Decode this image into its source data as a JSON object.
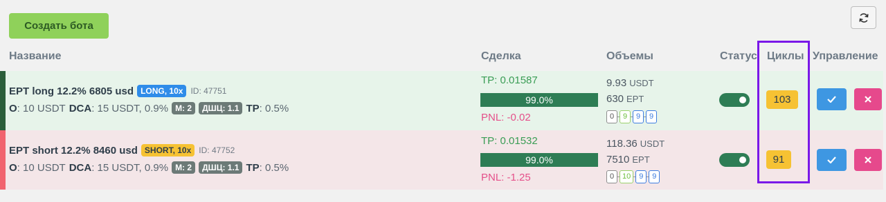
{
  "toolbar": {
    "create_label": "Создать бота",
    "refresh_icon": "refresh-icon"
  },
  "headers": {
    "name": "Название",
    "deal": "Сделка",
    "volumes": "Объемы",
    "status": "Статус",
    "cycles": "Циклы",
    "control": "Управление"
  },
  "bots": [
    {
      "title": "EPT long 12.2% 6805 usd",
      "badge": "LONG, 10x",
      "id": "ID: 47751",
      "o_label": "O",
      "o_value": ": 10 USDT",
      "dca_label": "DCA",
      "dca_value": ": 15 USDT, 0.9%",
      "m_chip": "M: 2",
      "dsh_chip": "ДШЦ: 1.1",
      "tp_label": "TP",
      "tp_value": ": 0.5%",
      "deal_tp": "TP: 0.01587",
      "progress_text": "99.0%",
      "progress": 0.99,
      "pnl": "PNL: -0.02",
      "vol_usdt": "9.93",
      "vol_usdt_unit": "USDT",
      "vol_ept": "630",
      "vol_ept_unit": "EPT",
      "cycle_boxes": [
        "0",
        "9",
        "9",
        "9"
      ],
      "enabled": true,
      "cycles": "103"
    },
    {
      "title": "EPT short 12.2% 8460 usd",
      "badge": "SHORT, 10x",
      "id": "ID: 47752",
      "o_label": "O",
      "o_value": ": 10 USDT",
      "dca_label": "DCA",
      "dca_value": ": 15 USDT, 0.9%",
      "m_chip": "M: 2",
      "dsh_chip": "ДШЦ: 1.1",
      "tp_label": "TP",
      "tp_value": ": 0.5%",
      "deal_tp": "TP: 0.01532",
      "progress_text": "99.0%",
      "progress": 0.99,
      "pnl": "PNL: -1.25",
      "vol_usdt": "118.36",
      "vol_usdt_unit": "USDT",
      "vol_ept": "7510",
      "vol_ept_unit": "EPT",
      "cycle_boxes": [
        "0",
        "10",
        "9",
        "9"
      ],
      "enabled": true,
      "cycles": "91"
    }
  ],
  "colors": {
    "accent_green": "#8fd15a",
    "progress": "#2e7d55",
    "long_badge": "#2f8ce9",
    "short_badge": "#f6c233",
    "pnl": "#e5508a",
    "highlight": "#7a18e8"
  }
}
